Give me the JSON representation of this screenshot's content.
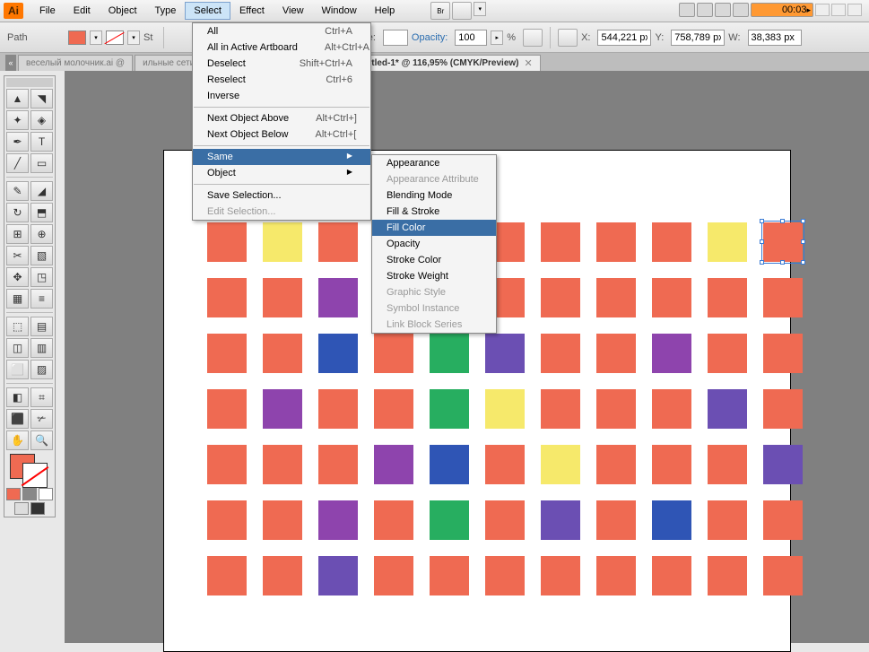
{
  "app_icon": "Ai",
  "menubar": [
    "File",
    "Edit",
    "Object",
    "Type",
    "Select",
    "Effect",
    "View",
    "Window",
    "Help"
  ],
  "menubar_open_index": 4,
  "top_right_time": "00:03",
  "controlbar": {
    "path_label": "Path",
    "stroke_label": "St",
    "style_label": "Style:",
    "opacity_label": "Opacity:",
    "opacity_value": "100",
    "opacity_unit": "%",
    "x_label": "X:",
    "x_value": "544,221 px",
    "y_label": "Y:",
    "y_value": "758,789 px",
    "w_label": "W:",
    "w_value": "38,383 px"
  },
  "tabs": [
    {
      "label": "веселый молочник.ai @",
      "active": false
    },
    {
      "label": "ильные сети.ai @ 104,24% (CMYK/Preview)",
      "active": false,
      "close": true
    },
    {
      "label": "Untitled-1* @ 116,95% (CMYK/Preview)",
      "active": true,
      "close": true
    }
  ],
  "select_menu": [
    {
      "label": "All",
      "shortcut": "Ctrl+A"
    },
    {
      "label": "All in Active Artboard",
      "shortcut": "Alt+Ctrl+A"
    },
    {
      "label": "Deselect",
      "shortcut": "Shift+Ctrl+A"
    },
    {
      "label": "Reselect",
      "shortcut": "Ctrl+6"
    },
    {
      "label": "Inverse"
    },
    {
      "sep": true
    },
    {
      "label": "Next Object Above",
      "shortcut": "Alt+Ctrl+]"
    },
    {
      "label": "Next Object Below",
      "shortcut": "Alt+Ctrl+["
    },
    {
      "sep": true
    },
    {
      "label": "Same",
      "sub": true,
      "highlight": true
    },
    {
      "label": "Object",
      "sub": true
    },
    {
      "sep": true
    },
    {
      "label": "Save Selection..."
    },
    {
      "label": "Edit Selection...",
      "disabled": true
    }
  ],
  "same_submenu": [
    {
      "label": "Appearance"
    },
    {
      "label": "Appearance Attribute",
      "disabled": true
    },
    {
      "label": "Blending Mode"
    },
    {
      "label": "Fill & Stroke"
    },
    {
      "label": "Fill Color",
      "highlight": true
    },
    {
      "label": "Opacity"
    },
    {
      "label": "Stroke Color"
    },
    {
      "label": "Stroke Weight"
    },
    {
      "label": "Graphic Style",
      "disabled": true
    },
    {
      "label": "Symbol Instance",
      "disabled": true
    },
    {
      "label": "Link Block Series",
      "disabled": true
    }
  ],
  "tool_glyphs": [
    "▲",
    "◥",
    "✦",
    "◈",
    "✒",
    "T",
    "╱",
    "▭",
    "✎",
    "◢",
    "↻",
    "⬒",
    "⊞",
    "⊕",
    "✂",
    "▧",
    "✥",
    "◳",
    "▦",
    "≡",
    "⬚",
    "▤",
    "◫",
    "▥",
    "⬜",
    "▨",
    "◧",
    "⌗",
    "⬛",
    "✃",
    "✋",
    "🔍"
  ],
  "colors": {
    "coral": "#ef6a52",
    "yellow": "#f6e96b",
    "purple": "#8e44ad",
    "green": "#27ae60",
    "blue": "#2f55b5",
    "violet": "#6b4fb3"
  },
  "grid": [
    [
      "coral",
      "yellow",
      "coral",
      "coral",
      "coral",
      "coral",
      "coral",
      "coral",
      "coral",
      "yellow",
      "coral"
    ],
    [
      "coral",
      "coral",
      "purple",
      "yellow",
      "coral",
      "coral",
      "coral",
      "coral",
      "coral",
      "coral",
      "coral"
    ],
    [
      "coral",
      "coral",
      "blue",
      "coral",
      "green",
      "violet",
      "coral",
      "coral",
      "purple",
      "coral",
      "coral"
    ],
    [
      "coral",
      "purple",
      "coral",
      "coral",
      "green",
      "yellow",
      "coral",
      "coral",
      "coral",
      "violet",
      "coral"
    ],
    [
      "coral",
      "coral",
      "coral",
      "purple",
      "blue",
      "coral",
      "yellow",
      "coral",
      "coral",
      "coral",
      "violet"
    ],
    [
      "coral",
      "coral",
      "purple",
      "coral",
      "green",
      "coral",
      "violet",
      "coral",
      "blue",
      "coral",
      "coral"
    ],
    [
      "coral",
      "coral",
      "violet",
      "coral",
      "coral",
      "coral",
      "coral",
      "coral",
      "coral",
      "coral",
      "coral"
    ]
  ],
  "selected_cell": {
    "row": 0,
    "col": 10
  }
}
